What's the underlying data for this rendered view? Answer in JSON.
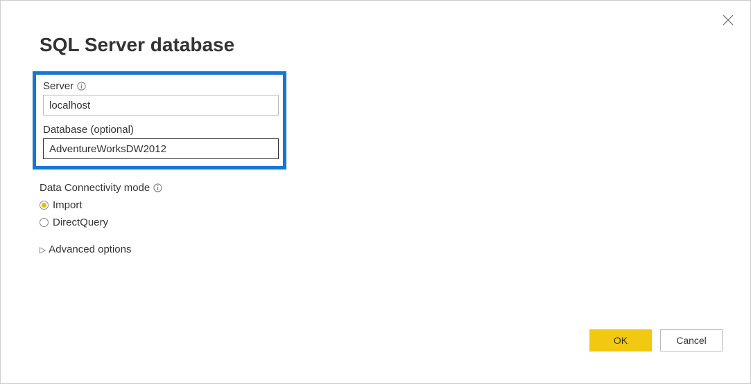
{
  "dialog": {
    "title": "SQL Server database",
    "server": {
      "label": "Server",
      "value": "localhost"
    },
    "database": {
      "label": "Database (optional)",
      "value": "AdventureWorksDW2012"
    },
    "connectivity": {
      "label": "Data Connectivity mode",
      "options": {
        "import": "Import",
        "directquery": "DirectQuery"
      },
      "selected": "import"
    },
    "advanced": {
      "label": "Advanced options"
    },
    "buttons": {
      "ok": "OK",
      "cancel": "Cancel"
    }
  }
}
